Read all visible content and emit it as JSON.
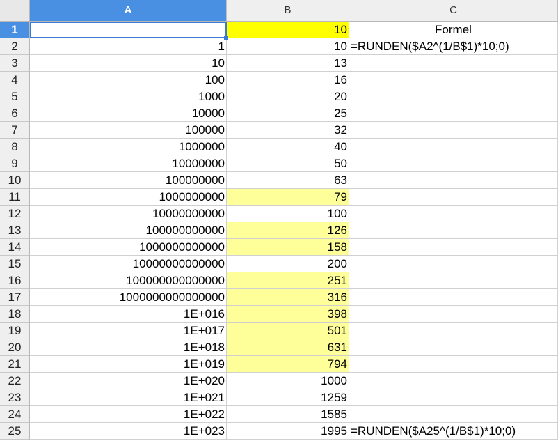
{
  "columns": [
    "A",
    "B",
    "C"
  ],
  "rows": [
    {
      "n": "1",
      "a": "",
      "b": "10",
      "c": "Formel",
      "b_fill": "strong"
    },
    {
      "n": "2",
      "a": "1",
      "b": "10",
      "c": "=RUNDEN($A2^(1/B$1)*10;0)",
      "b_fill": ""
    },
    {
      "n": "3",
      "a": "10",
      "b": "13",
      "c": "",
      "b_fill": ""
    },
    {
      "n": "4",
      "a": "100",
      "b": "16",
      "c": "",
      "b_fill": ""
    },
    {
      "n": "5",
      "a": "1000",
      "b": "20",
      "c": "",
      "b_fill": ""
    },
    {
      "n": "6",
      "a": "10000",
      "b": "25",
      "c": "",
      "b_fill": ""
    },
    {
      "n": "7",
      "a": "100000",
      "b": "32",
      "c": "",
      "b_fill": ""
    },
    {
      "n": "8",
      "a": "1000000",
      "b": "40",
      "c": "",
      "b_fill": ""
    },
    {
      "n": "9",
      "a": "10000000",
      "b": "50",
      "c": "",
      "b_fill": ""
    },
    {
      "n": "10",
      "a": "100000000",
      "b": "63",
      "c": "",
      "b_fill": ""
    },
    {
      "n": "11",
      "a": "1000000000",
      "b": "79",
      "c": "",
      "b_fill": "light"
    },
    {
      "n": "12",
      "a": "10000000000",
      "b": "100",
      "c": "",
      "b_fill": ""
    },
    {
      "n": "13",
      "a": "100000000000",
      "b": "126",
      "c": "",
      "b_fill": "light"
    },
    {
      "n": "14",
      "a": "1000000000000",
      "b": "158",
      "c": "",
      "b_fill": "light"
    },
    {
      "n": "15",
      "a": "10000000000000",
      "b": "200",
      "c": "",
      "b_fill": ""
    },
    {
      "n": "16",
      "a": "100000000000000",
      "b": "251",
      "c": "",
      "b_fill": "light"
    },
    {
      "n": "17",
      "a": "1000000000000000",
      "b": "316",
      "c": "",
      "b_fill": "light"
    },
    {
      "n": "18",
      "a": "1E+016",
      "b": "398",
      "c": "",
      "b_fill": "light"
    },
    {
      "n": "19",
      "a": "1E+017",
      "b": "501",
      "c": "",
      "b_fill": "light"
    },
    {
      "n": "20",
      "a": "1E+018",
      "b": "631",
      "c": "",
      "b_fill": "light"
    },
    {
      "n": "21",
      "a": "1E+019",
      "b": "794",
      "c": "",
      "b_fill": "light"
    },
    {
      "n": "22",
      "a": "1E+020",
      "b": "1000",
      "c": "",
      "b_fill": ""
    },
    {
      "n": "23",
      "a": "1E+021",
      "b": "1259",
      "c": "",
      "b_fill": ""
    },
    {
      "n": "24",
      "a": "1E+022",
      "b": "1585",
      "c": "",
      "b_fill": ""
    },
    {
      "n": "25",
      "a": "1E+023",
      "b": "1995",
      "c": "=RUNDEN($A25^(1/B$1)*10;0)",
      "b_fill": ""
    }
  ],
  "selected_cell": "A1",
  "colors": {
    "selection": "#3a7bd5",
    "highlight_strong": "#ffff00",
    "highlight_light": "#ffff99"
  }
}
